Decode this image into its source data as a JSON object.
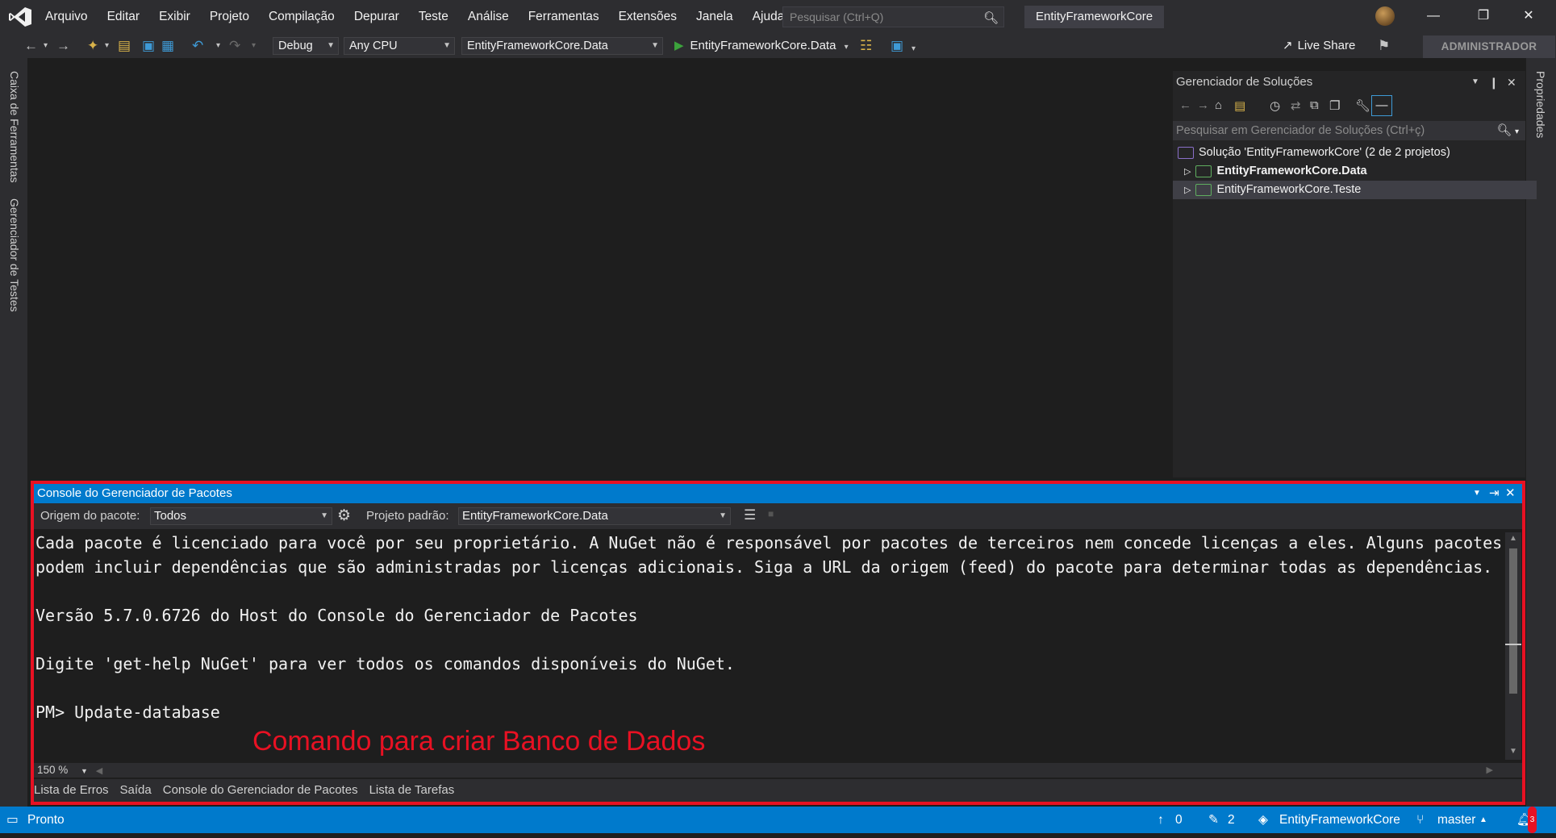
{
  "menubar": {
    "items": [
      "Arquivo",
      "Editar",
      "Exibir",
      "Projeto",
      "Compilação",
      "Depurar",
      "Teste",
      "Análise",
      "Ferramentas",
      "Extensões",
      "Janela",
      "Ajuda"
    ],
    "search_placeholder": "Pesquisar (Ctrl+Q)",
    "solution_name": "EntityFrameworkCore"
  },
  "toolbar": {
    "configuration": "Debug",
    "platform": "Any CPU",
    "startup_project": "EntityFrameworkCore.Data",
    "run_target": "EntityFrameworkCore.Data",
    "live_share": "Live Share",
    "admin": "ADMINISTRADOR"
  },
  "left_tabs": [
    "Caixa de Ferramentas",
    "Gerenciador de Testes"
  ],
  "right_tabs": [
    "Propriedades"
  ],
  "solution_explorer": {
    "title": "Gerenciador de Soluções",
    "search_placeholder": "Pesquisar em Gerenciador de Soluções (Ctrl+ç)",
    "solution_label": "Solução 'EntityFrameworkCore' (2 de 2 projetos)",
    "projects": [
      {
        "name": "EntityFrameworkCore.Data",
        "bold": true
      },
      {
        "name": "EntityFrameworkCore.Teste",
        "bold": false,
        "selected": true
      }
    ]
  },
  "package_console": {
    "title": "Console do Gerenciador de Pacotes",
    "source_label": "Origem do pacote:",
    "source_value": "Todos",
    "project_label": "Projeto padrão:",
    "project_value": "EntityFrameworkCore.Data",
    "lines": [
      "Cada pacote é licenciado para você por seu proprietário. A NuGet não é responsável por pacotes de terceiros nem concede licenças a eles. Alguns pacotes podem incluir dependências que são administradas por licenças adicionais. Siga a URL da origem (feed) do pacote para determinar todas as dependências.",
      "",
      "Versão 5.7.0.6726 do Host do Console do Gerenciador de Pacotes",
      "",
      "Digite 'get-help NuGet' para ver todos os comandos disponíveis do NuGet.",
      "",
      "PM> Update-database"
    ],
    "annotation": "Comando para criar Banco de Dados",
    "zoom": "150 %",
    "tabs": [
      "Lista de Erros",
      "Saída",
      "Console do Gerenciador de Pacotes",
      "Lista de Tarefas"
    ]
  },
  "statusbar": {
    "status": "Pronto",
    "push_count": "0",
    "pending_changes": "2",
    "repo": "EntityFrameworkCore",
    "branch": "master",
    "notifications": "3"
  },
  "colors": {
    "accent": "#007acc",
    "annotation_red": "#e81123",
    "background": "#1e1e1e",
    "chrome": "#2d2d30"
  }
}
